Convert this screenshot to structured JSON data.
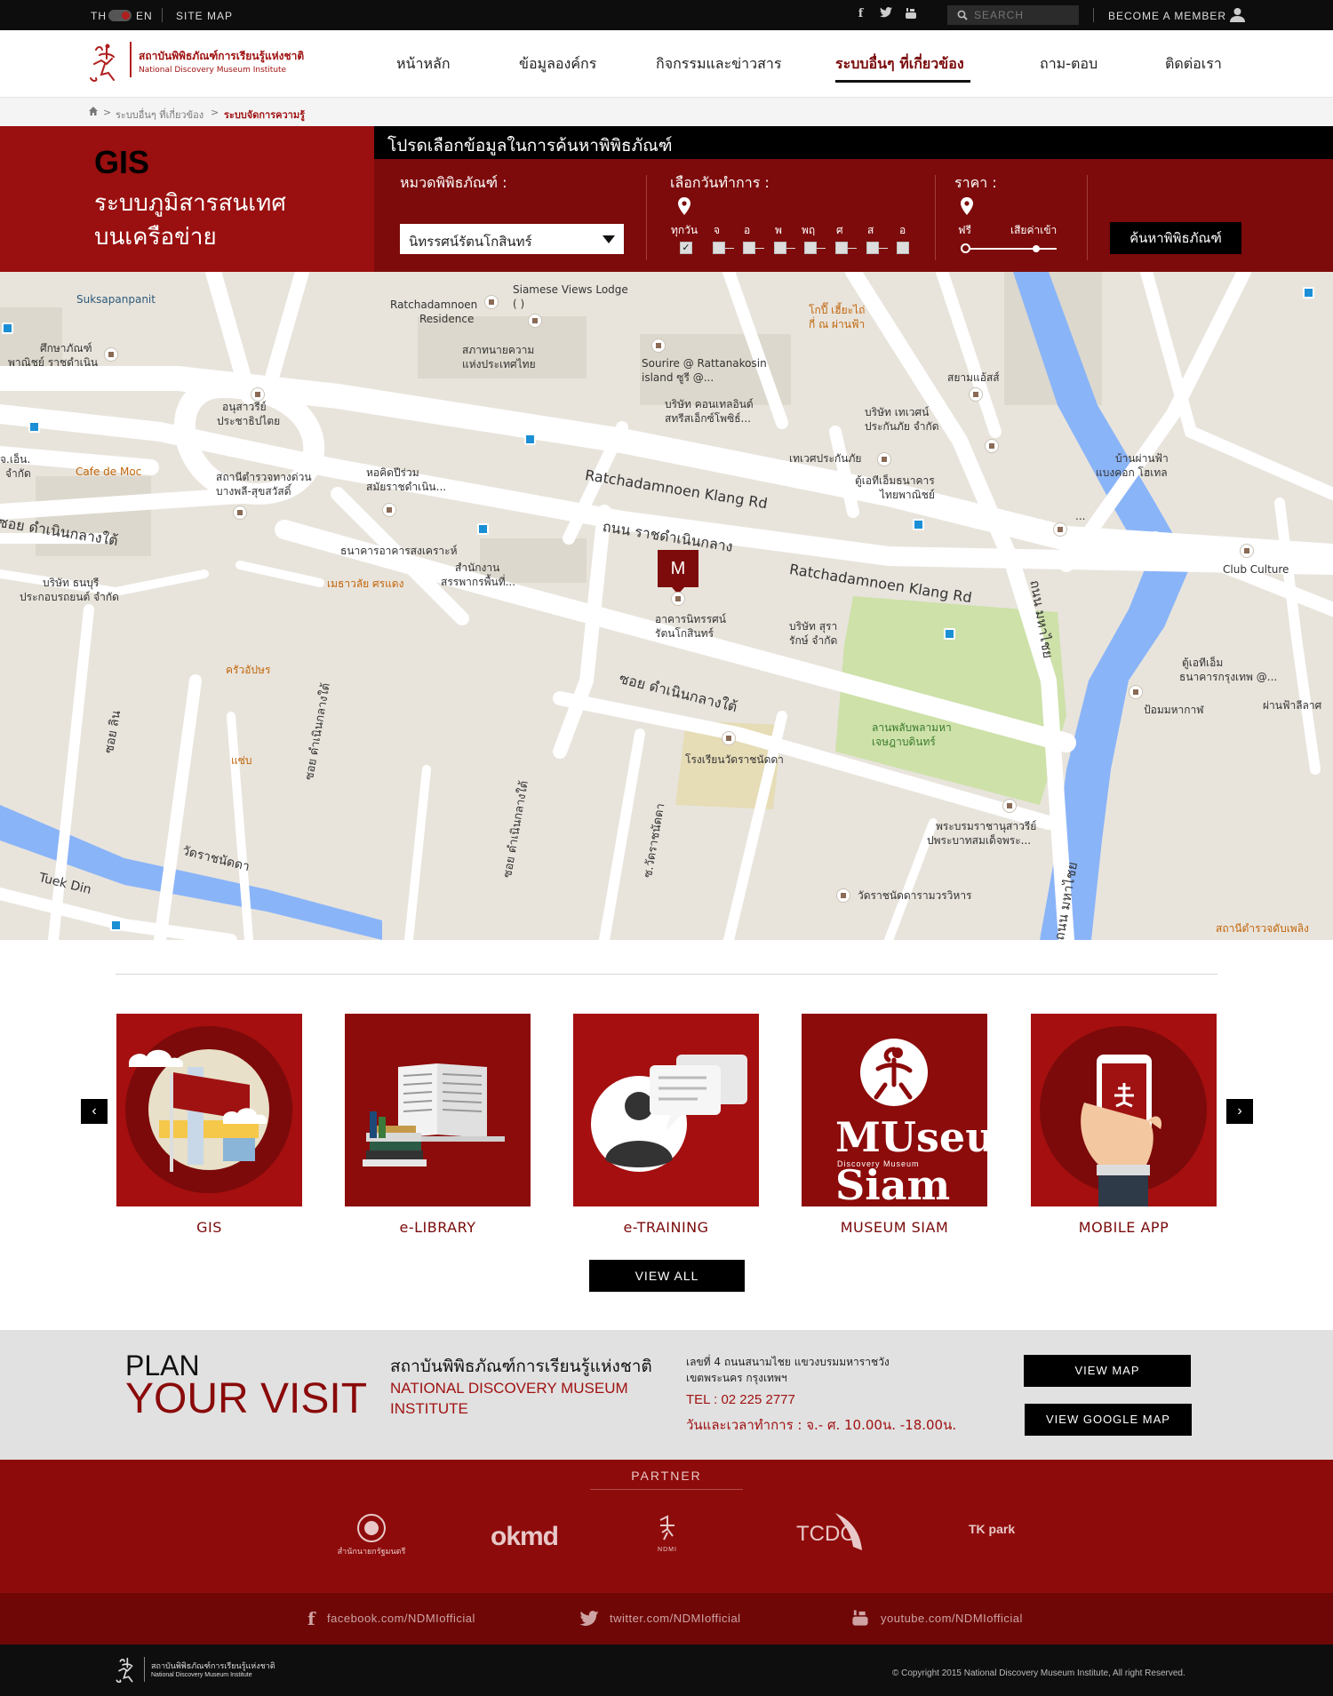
{
  "topbar": {
    "lang_th": "TH",
    "lang_en": "EN",
    "sitemap": "SITE MAP",
    "search_placeholder": "SEARCH",
    "member": "BECOME A MEMBER"
  },
  "header": {
    "logo_th": "สถาบันพิพิธภัณฑ์การเรียนรู้แห่งชาติ",
    "logo_en": "National Discovery Museum Institute",
    "nav": [
      {
        "label": "หน้าหลัก"
      },
      {
        "label": "ข้อมูลองค์กร"
      },
      {
        "label": "กิจกรรมและข่าวสาร"
      },
      {
        "label": "ระบบอื่นๆ ที่เกี่ยวข้อง"
      },
      {
        "label": "ถาม-ตอบ"
      },
      {
        "label": "ติดต่อเรา"
      }
    ]
  },
  "breadcrumb": {
    "home_icon": "home-icon",
    "items": [
      "ระบบอื่นๆ ที่เกี่ยวข้อง",
      "ระบบจัดการความรู้"
    ]
  },
  "gis_panel": {
    "title": "GIS",
    "subtitle_line1": "ระบบภูมิสารสนเทศ",
    "subtitle_line2": "บนเครือข่าย"
  },
  "search_panel": {
    "heading": "โปรดเลือกข้อมูลในการค้นหาพิพิธภัณฑ์",
    "category_label": "หมวดพิพิธภัณฑ์ :",
    "category_value": "นิทรรศน์รัตนโกสินทร์",
    "days_label": "เลือกวันทำการ :",
    "days": [
      "ทุกวัน",
      "จ",
      "อ",
      "พ",
      "พฤ",
      "ศ",
      "ส",
      "อ"
    ],
    "days_checked": [
      true,
      false,
      false,
      false,
      false,
      false,
      false,
      false
    ],
    "price_label": "ราคา :",
    "price_free": "ฟรี",
    "price_paid": "เสียค่าเข้า",
    "search_button": "ค้นหาพิพิธภัณฑ์"
  },
  "map": {
    "marker_label": "M",
    "labels": {
      "suksapanpanit": "Suksapanpanit",
      "siamese": "Siamese Views Lodge",
      "siamese2": "(               )",
      "ratch_res1": "Ratchadamnoen",
      "ratch_res2": "Residence",
      "kotpi1": "โกปี๊ เฮี้ยะไถ่",
      "kotpi2": "กี่ ณ ผ่านฟ้า",
      "sueksa1": "ศึกษาภัณฑ์",
      "sueksa2": "พาณิชย์ ราชดำเนิน",
      "lawyer1": "สภาทนายความ",
      "lawyer2": "แห่งประเทศไทย",
      "sourire1": "Sourire @ Rattanakosin",
      "sourire2": "island ซูรี @...",
      "siamast": "สยามแอ้สส์",
      "condo1": "บริษัท คอนเทลอินด์",
      "condo2": "สทรีสเอ็กซ์โพซิธ์...",
      "monument1": "อนุสาวรีย์",
      "monument2": "ประชาธิปไตย",
      "travel1": "บริษัท เทเวศน์",
      "travel2": "ประกันภัย จำกัด",
      "jeo1": "จ.เอ็น.",
      "jeo2": "จำกัด",
      "cafe": "Cafe de Moc",
      "police1": "สถานีตำรวจทางด่วน",
      "police2": "บางพลี-สุขสวัสดิ์",
      "hall1": "หอคิดปีร่วม",
      "hall2": "สมัยราชดำเนิน...",
      "tewet": "เทเวศประกันภัย",
      "atm1": "ตู้เอทีเอ็มธนาคาร",
      "atm2": "ไทยพาณิชย์",
      "banphan1": "บ้านผ่านฟ้า",
      "banphan2": "แบงคอก โฮเทล",
      "soi_dumnoen": "ซอย ดำเนินกลางใต้",
      "ratch_klang_rd1": "Ratchadamnoen Klang Rd",
      "thanon_ratch": "ถนน ราชดำเนินกลาง",
      "ratch_klang_rd2": "Ratchadamnoen Klang Rd",
      "housing": "ธนาคารอาคารสงเคราะห์",
      "dots": "...",
      "thonburi1": "บริษัท ธนบุรี",
      "thonburi2": "ประกอบรถยนต์ จำกัด",
      "revenue1": "สำนักงาน",
      "revenue2": "สรรพากรพื้นที่...",
      "maesai": "เมธาวลัย ศรแดง",
      "nitat1": "อาคารนิทรรศน์",
      "nitat2": "รัตนโกสินทร์",
      "sura1": "บริษัท สุรา",
      "sura2": "รักษ์ จำกัด",
      "club": "Club Culture",
      "mahachai": "ถนน มหาไชย",
      "krua": "ครัวอัปษร",
      "soi_dumnoen2": "ซอย ดำเนินกลางใต้",
      "atm3": "ตู้เอทีเอ็ม",
      "atm4": "ธนาคารกรุงเทพ @...",
      "phanfa": "ผ่านฟ้าลีลาศ",
      "pomm": "ป้อมมหากาฬ",
      "lanplapla1": "ลานพลับพลามหา",
      "lanplapla2": "เจษฎาบดินทร์",
      "school": "โรงเรียนวัดราชนัดดา",
      "soi_lin": "ซอย ลิน",
      "saep": "แซ่บ",
      "soi_dn1": "ซอย ดำเนินกลางใต้",
      "soi_dn2": "ซอย ดำเนินกลางใต้",
      "king1": "พระบรมราชานุสาวรีย์",
      "king2": "ปพระบาทสมเด็จพระ...",
      "watratch_rd": "วัดราชนัดดา",
      "tuekdin": "Tuek Din",
      "soi_watratch": "ซ.วัดราชนัดดา",
      "mahachai2": "ถนน มหาไชย",
      "watratcha": "วัดราชนัดดารามวรวิหาร",
      "police3": "สถานีตำรวจดับเพลิง"
    }
  },
  "systems": {
    "cards": [
      {
        "title": "GIS",
        "icon": "gis-map-flag-icon"
      },
      {
        "title": "e-LIBRARY",
        "icon": "open-book-icon"
      },
      {
        "title": "e-TRAINING",
        "icon": "person-chat-icon"
      },
      {
        "title": "MUSEUM SIAM",
        "icon": "museum-siam-logo"
      },
      {
        "title": "MOBILE APP",
        "icon": "hand-phone-icon"
      }
    ],
    "museum_siam_logo_text": "MUseum Siam",
    "museum_siam_sub": "Discovery Museum",
    "view_all": "VIEW ALL"
  },
  "plan": {
    "plan": "PLAN",
    "your_visit": "YOUR VISIT",
    "inst_th": "สถาบันพิพิธภัณฑ์การเรียนรู้แห่งชาติ",
    "inst_en1": "NATIONAL DISCOVERY MUSEUM",
    "inst_en2": "INSTITUTE",
    "addr1": "เลขที่ 4 ถนนสนามไชย แขวงบรมมหาราชวัง",
    "addr2": "เขตพระนคร กรุงเทพฯ",
    "tel": "TEL : 02 225 2777",
    "hours": "วันและเวลาทำการ : จ.- ศ. 10.00น. -18.00น.",
    "view_map": "VIEW MAP",
    "view_google_map": "VIEW GOOGLE MAP"
  },
  "partner": {
    "heading": "PARTNER",
    "logos": [
      {
        "name": "สำนักนายกรัฐมนตรี"
      },
      {
        "name": "okmd"
      },
      {
        "name": "NDMI"
      },
      {
        "name": "TCDC"
      },
      {
        "name": "TK park"
      }
    ]
  },
  "social": {
    "facebook": "facebook.com/NDMIofficial",
    "twitter": "twitter.com/NDMIofficial",
    "youtube": "youtube.com/NDMIofficial"
  },
  "footer": {
    "logo_th": "สถาบันพิพิธภัณฑ์การเรียนรู้แห่งชาติ",
    "logo_en": "National Discovery Museum Institute",
    "copyright": "© Copyright 2015 National Discovery Museum Institute, All right Reserved."
  },
  "colors": {
    "brand_red": "#9a0f0f",
    "dark_red": "#7d0b0b",
    "black": "#000000"
  }
}
